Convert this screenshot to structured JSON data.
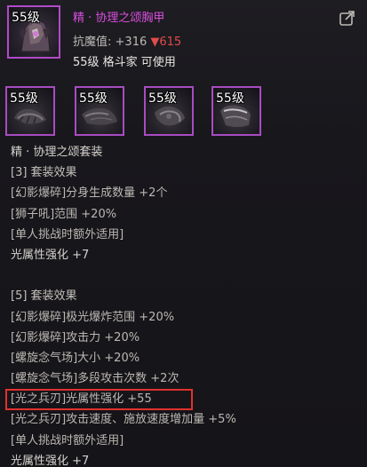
{
  "item": {
    "level_badge": "55级",
    "name": "精 · 协理之颂胸甲",
    "resist_label": "抗魔值:",
    "resist_plus": "+316",
    "resist_down": "▼615",
    "requirement": "55级 格斗家 可使用",
    "share_icon": "share-icon",
    "rarity_color": "#d94fe0"
  },
  "set_pieces": [
    {
      "level_badge": "55级",
      "icon": "armor-piece-icon"
    },
    {
      "level_badge": "55级",
      "icon": "armor-piece-icon"
    },
    {
      "level_badge": "55级",
      "icon": "armor-piece-icon"
    },
    {
      "level_badge": "55级",
      "icon": "armor-piece-icon"
    }
  ],
  "set_name": "精 · 协理之颂套装",
  "set3": {
    "header": "[3] 套装效果",
    "lines": [
      "[幻影爆碎]分身生成数量 +2个",
      "[狮子吼]范围 +20%",
      "[单人挑战时额外适用]",
      "光属性强化 +7"
    ]
  },
  "set5": {
    "header": "[5] 套装效果",
    "lines": [
      "[幻影爆碎]极光爆炸范围 +20%",
      "[幻影爆碎]攻击力 +20%",
      "[螺旋念气场]大小 +20%",
      "[螺旋念气场]多段攻击次数 +2次",
      "[光之兵刃]光属性强化 +55",
      "[光之兵刃]攻击速度、施放速度增加量 +5%",
      "[单人挑战时额外适用]",
      "光属性强化 +7"
    ]
  },
  "colors": {
    "highlight_border": "#e0312e",
    "negative": "#e04b4b",
    "slot_border": "#a84cc0"
  }
}
